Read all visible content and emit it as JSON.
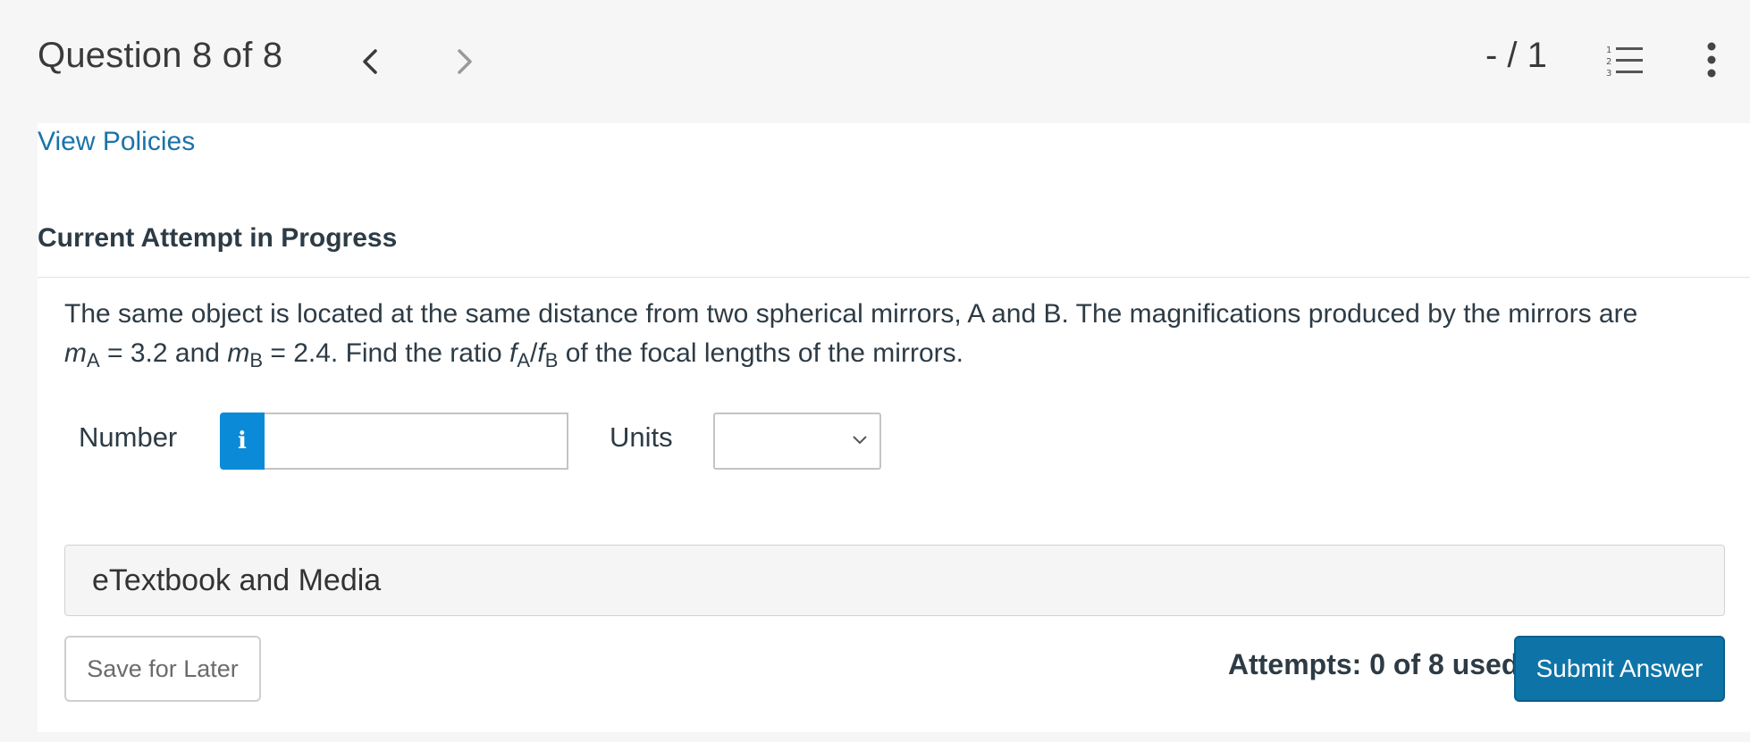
{
  "header": {
    "question_title": "Question 8 of 8",
    "score": "- / 1",
    "prev_icon": "chevron-left-icon",
    "next_icon": "chevron-right-icon",
    "list_icon": "numbered-list-icon",
    "menu_icon": "more-vertical-icon"
  },
  "links": {
    "view_policies": "View Policies"
  },
  "attempt": {
    "heading": "Current Attempt in Progress"
  },
  "question": {
    "line1": "The same object is located at the same distance from two spherical mirrors, A and B. The magnifications produced by the mirrors are",
    "m_var": "m",
    "sub_a": "A",
    "eq_a": " = 3.2 and ",
    "sub_b": "B",
    "eq_b": " = 2.4. Find the ratio ",
    "f_var": "f",
    "slash": "/",
    "tail": " of the focal lengths of the mirrors."
  },
  "answer": {
    "number_label": "Number",
    "info_glyph": "i",
    "number_value": "",
    "units_label": "Units",
    "units_selected": ""
  },
  "resources": {
    "etextbook_label": "eTextbook and Media"
  },
  "actions": {
    "save_label": "Save for Later",
    "attempts_text": "Attempts: 0 of 8 used",
    "submit_label": "Submit Answer"
  },
  "colors": {
    "link": "#1a73a8",
    "info_button": "#0b8ad8",
    "submit_button": "#0e74a8"
  }
}
